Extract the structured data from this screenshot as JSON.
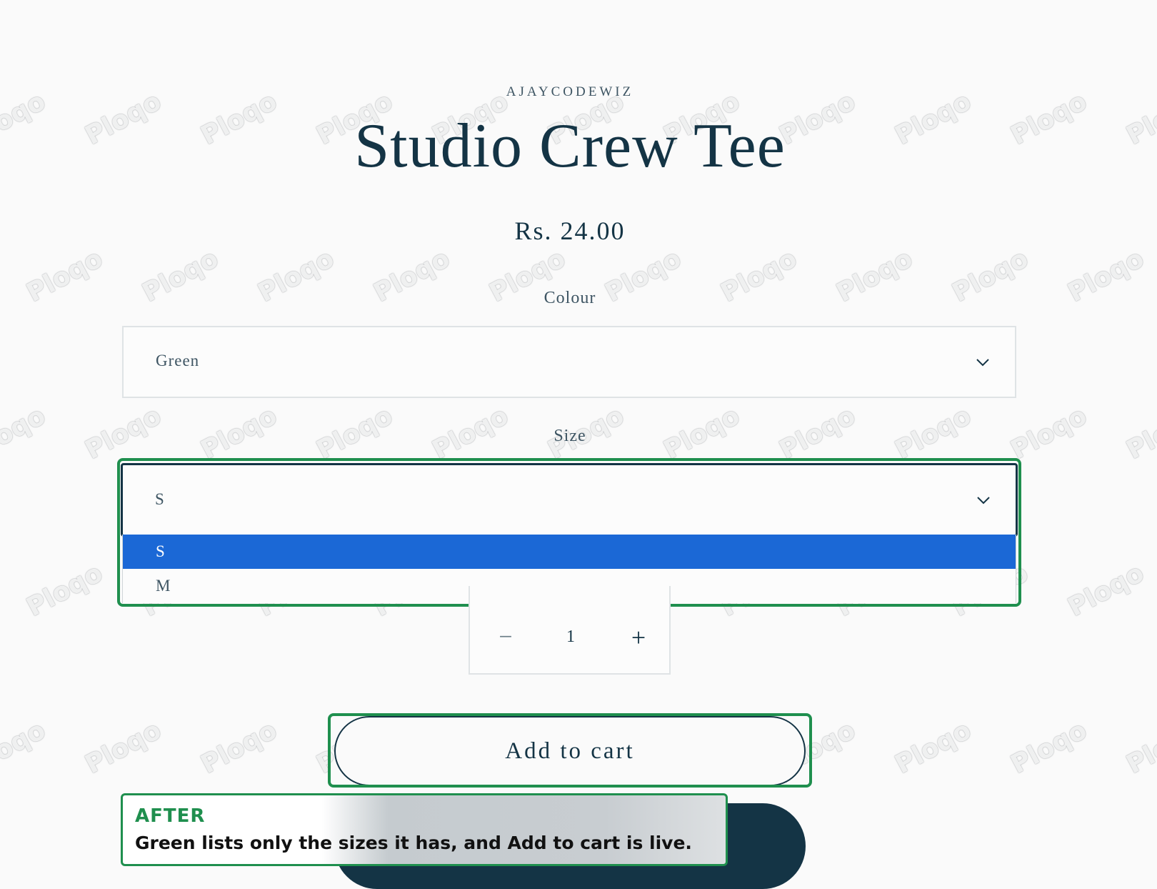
{
  "product": {
    "vendor": "AJAYCODEWIZ",
    "title": "Studio Crew Tee",
    "price": "Rs. 24.00"
  },
  "colour_option": {
    "label": "Colour",
    "selected": "Green",
    "icon": "chevron-down-icon"
  },
  "size_option": {
    "label": "Size",
    "selected": "S",
    "icon": "chevron-down-icon",
    "options": [
      {
        "label": "S",
        "highlighted": true
      },
      {
        "label": "M",
        "highlighted": false
      }
    ]
  },
  "quantity": {
    "value": "1",
    "decrease_label": "−",
    "increase_label": "+"
  },
  "add_to_cart": {
    "label": "Add to cart"
  },
  "annotation": {
    "tag": "AFTER",
    "text": "Green lists only the sizes it has, and Add to cart is live."
  },
  "watermark": {
    "text": "Ploqo"
  },
  "colors": {
    "text_dark": "#143445",
    "option_highlight": "#1b68d6",
    "annotation_green": "#1f8f4e"
  }
}
